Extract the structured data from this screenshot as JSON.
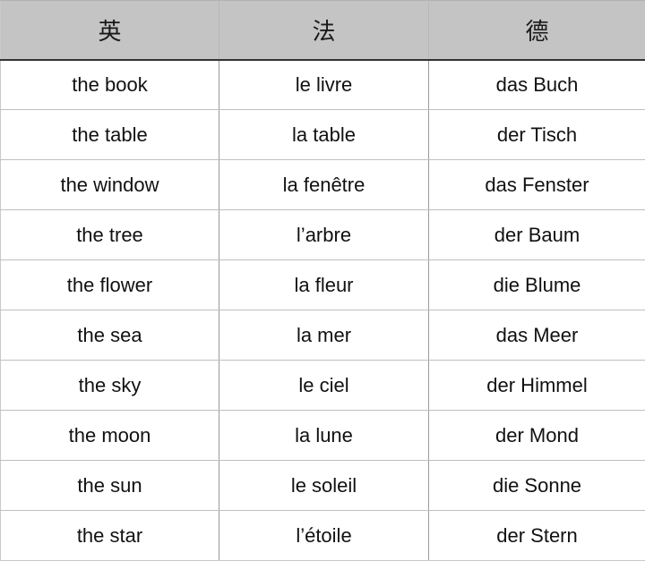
{
  "table": {
    "headers": [
      {
        "label": "英",
        "language": "English"
      },
      {
        "label": "法",
        "language": "French"
      },
      {
        "label": "德",
        "language": "German"
      }
    ],
    "rows": [
      {
        "en": "the book",
        "fr": "le livre",
        "de": "das Buch"
      },
      {
        "en": "the table",
        "fr": "la table",
        "de": "der Tisch"
      },
      {
        "en": "the window",
        "fr": "la fenêtre",
        "de": "das Fenster"
      },
      {
        "en": "the tree",
        "fr": "l’arbre",
        "de": "der Baum"
      },
      {
        "en": "the flower",
        "fr": "la fleur",
        "de": "die Blume"
      },
      {
        "en": "the sea",
        "fr": "la mer",
        "de": "das Meer"
      },
      {
        "en": "the sky",
        "fr": "le ciel",
        "de": "der Himmel"
      },
      {
        "en": "the moon",
        "fr": "la lune",
        "de": "der Mond"
      },
      {
        "en": "the sun",
        "fr": "le soleil",
        "de": "die Sonne"
      },
      {
        "en": "the star",
        "fr": "l’étoile",
        "de": "der Stern"
      }
    ],
    "colors": {
      "header_background": "#c4c4c4",
      "header_text": "#1a1a1a",
      "header_bottom_border": "#333333",
      "row_divider": "#bfbfbf",
      "column_divider": "#9a9a9a",
      "cell_background": "#ffffff",
      "cell_text": "#111111"
    }
  }
}
